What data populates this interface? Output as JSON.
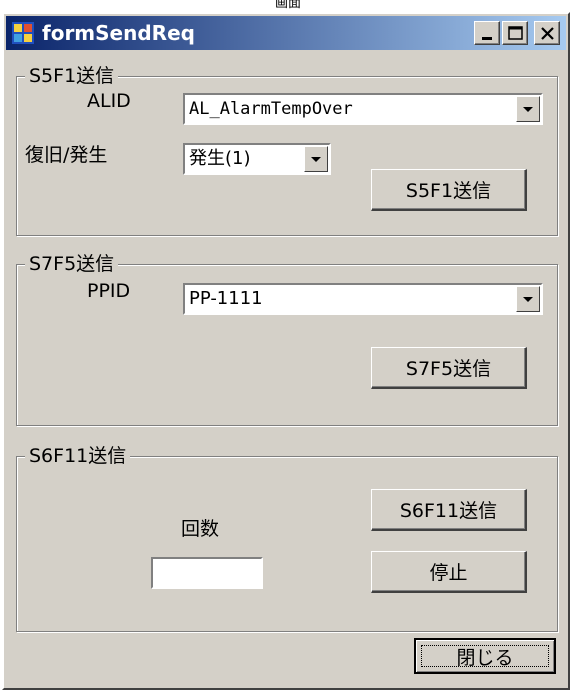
{
  "caption_above": "画面",
  "window": {
    "title": "formSendReq",
    "icon": "windows-form-icon",
    "controls": [
      "minimize-icon",
      "maximize-icon",
      "close-icon"
    ]
  },
  "s5f1": {
    "group_title": "S5F1送信",
    "alid_label": "ALID",
    "alid_value": "AL_AlarmTempOver",
    "recover_label": "復旧/発生",
    "recover_value": "発生(1)",
    "send_button": "S5F1送信"
  },
  "s7f5": {
    "group_title": "S7F5送信",
    "ppid_label": "PPID",
    "ppid_value": "PP-1111",
    "send_button": "S7F5送信"
  },
  "s6f11": {
    "group_title": "S6F11送信",
    "count_label": "回数",
    "count_value": "",
    "send_button": "S6F11送信",
    "stop_button": "停止"
  },
  "close_button": "閉じる",
  "colors": {
    "face": "#d4d0c8",
    "title_start": "#0a246a",
    "title_end": "#a6caf0"
  }
}
